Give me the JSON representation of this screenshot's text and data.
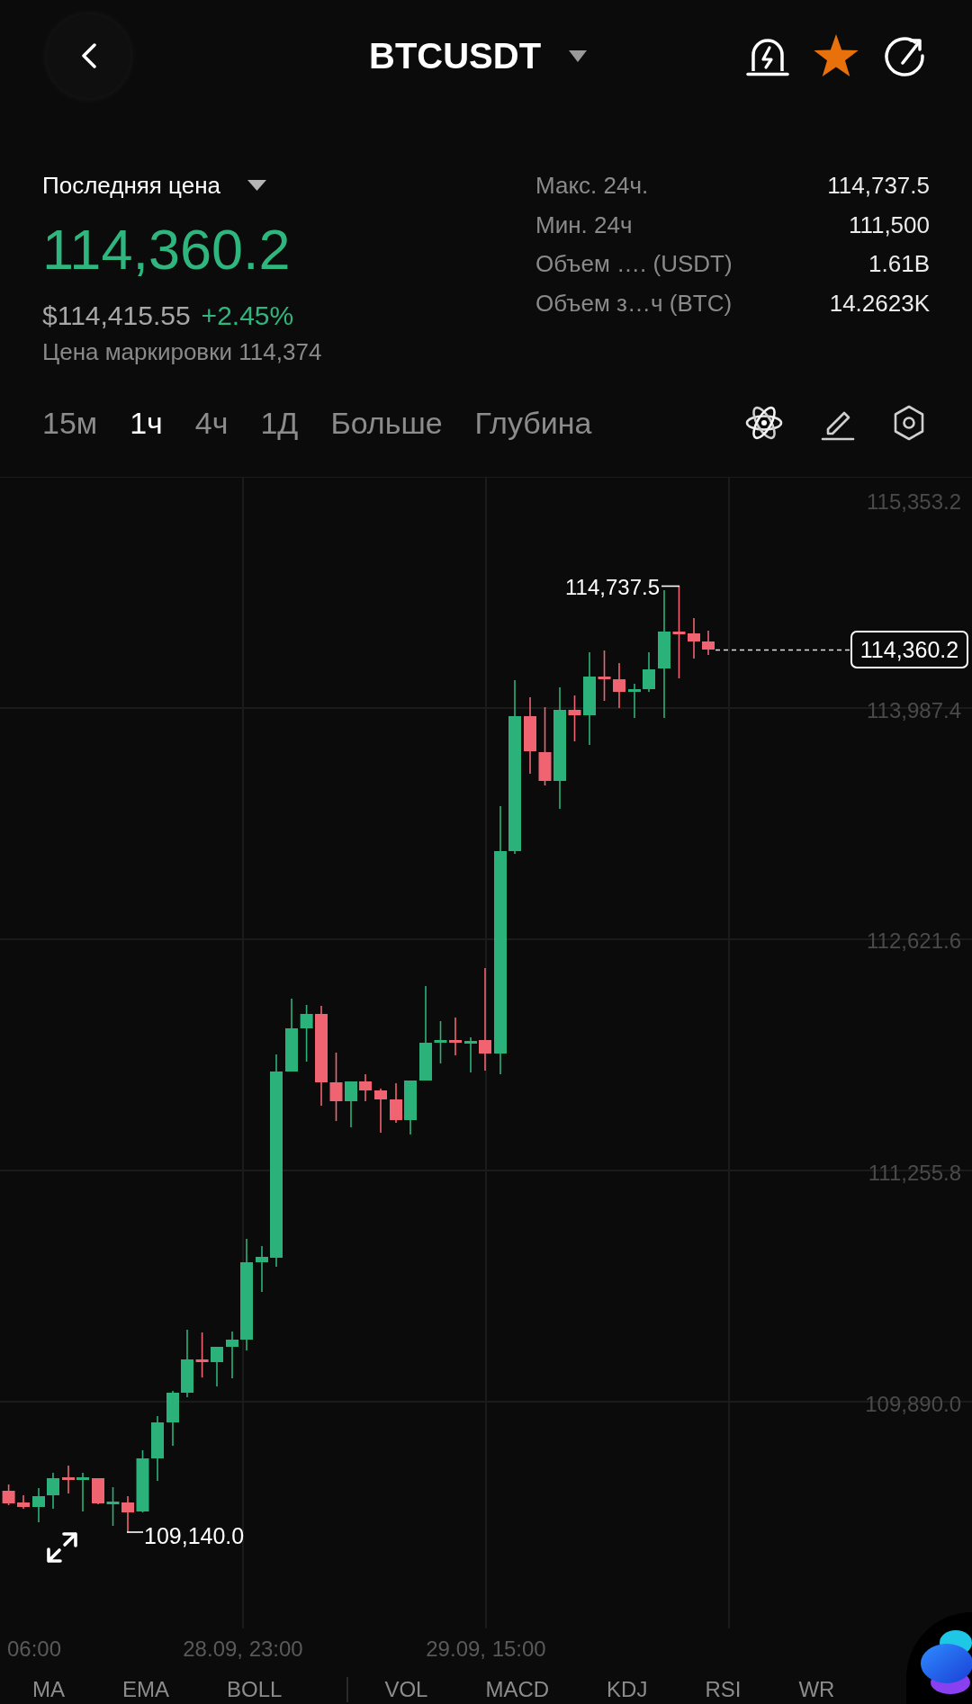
{
  "header": {
    "title": "BTCUSDT",
    "favorite": true
  },
  "price_panel": {
    "price_type": "Последняя цена",
    "last_price": "114,360.2",
    "usd_price": "$114,415.55",
    "change": "+2.45%",
    "mark_price": "Цена маркировки 114,374"
  },
  "stats": [
    {
      "label": "Макс. 24ч.",
      "value": "114,737.5"
    },
    {
      "label": "Мин. 24ч",
      "value": "111,500"
    },
    {
      "label": "Объем …. (USDT)",
      "value": "1.61B"
    },
    {
      "label": "Объем з…ч (BTC)",
      "value": "14.2623K"
    }
  ],
  "timeframes": [
    {
      "label": "15м",
      "selected": false
    },
    {
      "label": "1ч",
      "selected": true
    },
    {
      "label": "4ч",
      "selected": false
    },
    {
      "label": "1Д",
      "selected": false
    },
    {
      "label": "Больше",
      "selected": false
    },
    {
      "label": "Глубина",
      "selected": false
    }
  ],
  "chart": {
    "y_axis_labels": [
      "115,353.2",
      "113,987.4",
      "112,621.6",
      "111,255.8",
      "109,890.0"
    ],
    "x_axis_labels": [
      "06:00",
      "28.09, 23:00",
      "29.09, 15:00"
    ],
    "high_label": "114,737.5",
    "low_label": "109,140.0",
    "last_price_tag": "114,360.2"
  },
  "indicators": {
    "main": [
      "MA",
      "EMA",
      "BOLL"
    ],
    "sub": [
      "VOL",
      "MACD",
      "KDJ",
      "RSI",
      "WR"
    ]
  }
}
